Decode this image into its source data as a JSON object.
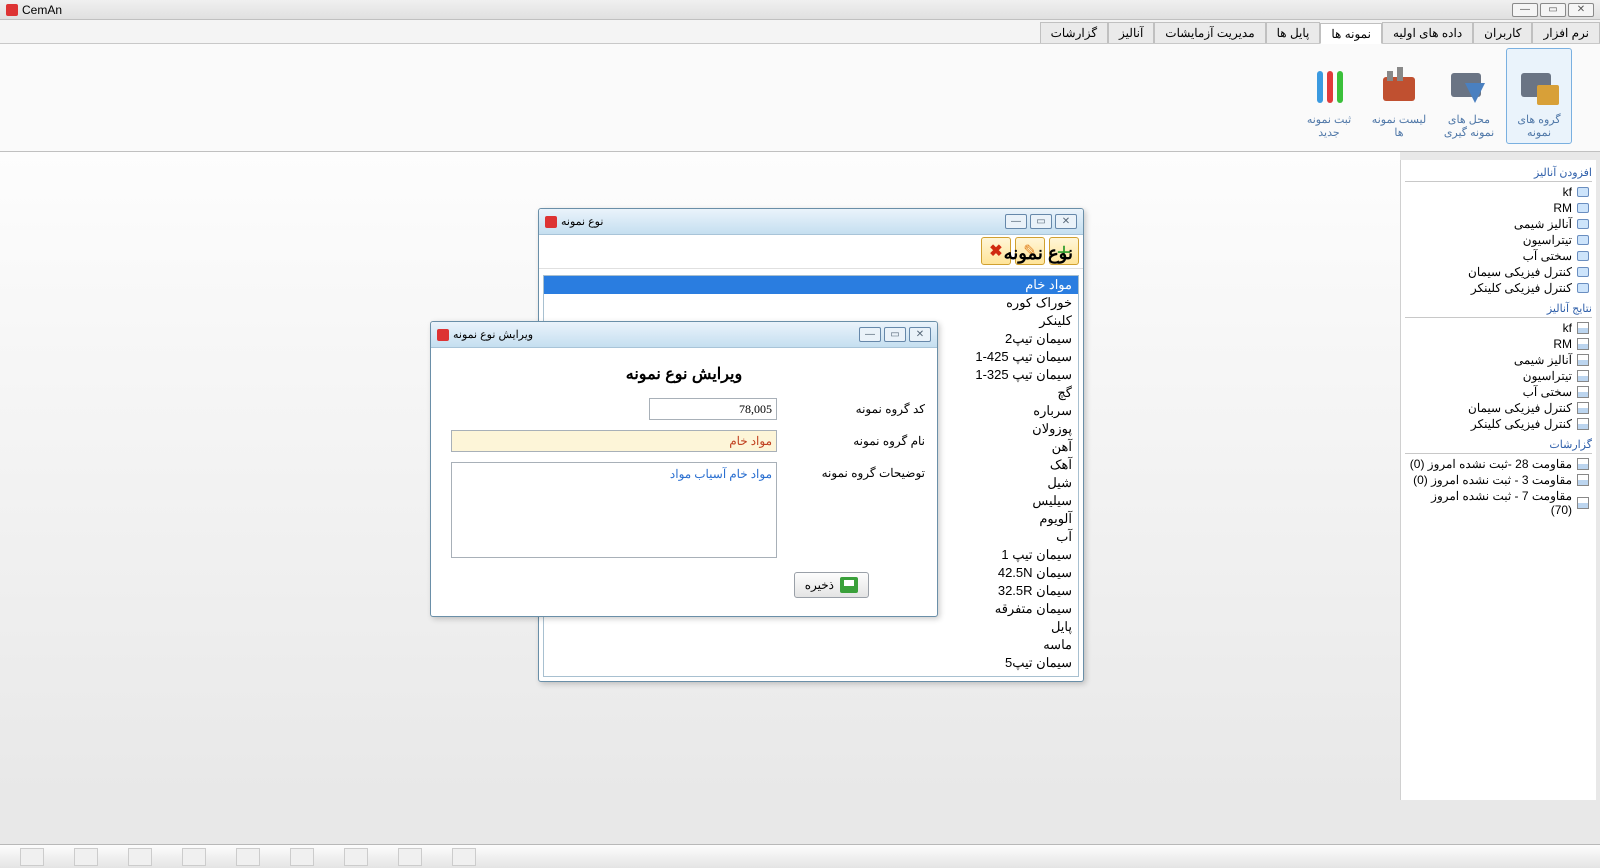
{
  "app": {
    "title": "CemAn"
  },
  "tabs": [
    "نرم افزار",
    "کاربران",
    "داده های اولیه",
    "نمونه ها",
    "پایل ها",
    "مدیریت آزمایشات",
    "آنالیز",
    "گزارشات"
  ],
  "active_tab_index": 3,
  "ribbon": [
    {
      "label": "گروه های نمونه",
      "hl": true
    },
    {
      "label": "محل های نمونه گیری",
      "hl": false
    },
    {
      "label": "لیست نمونه ها",
      "hl": false
    },
    {
      "label": "ثبت نمونه جدید",
      "hl": false
    }
  ],
  "right_panel": {
    "sections": [
      {
        "title": "افزودن آنالیز",
        "icon": "blue",
        "items": [
          "kf",
          "RM",
          "آنالیز شیمی",
          "تیتراسیون",
          "سختی آب",
          "کنترل فیزیکی سیمان",
          "کنترل فیزیکی کلینکر"
        ]
      },
      {
        "title": "نتایج آنالیز",
        "icon": "form",
        "items": [
          "kf",
          "RM",
          "آنالیز شیمی",
          "تیتراسیون",
          "سختی آب",
          "کنترل فیزیکی سیمان",
          "کنترل فیزیکی کلینکر"
        ]
      },
      {
        "title": "گزارشات",
        "icon": "form",
        "items": [
          "مقاومت 28 -ثبت نشده امروز (0)",
          "مقاومت 3 - ثبت نشده امروز (0)",
          "مقاومت 7 - ثبت نشده امروز (70)"
        ]
      }
    ]
  },
  "dlg1": {
    "title": "نوع نمونه",
    "heading": "نوع نمونه",
    "items": [
      "مواد خام",
      "خوراک کوره",
      "کلینکر",
      "سیمان تیپ2",
      "سیمان تیپ 425-1",
      "سیمان تیپ 325-1",
      "گچ",
      "سرباره",
      "پوزولان",
      "آهن",
      "آهک",
      "شیل",
      "سیلیس",
      "آلویوم",
      "آب",
      "سیمان تیپ 1",
      "سیمان 42.5N",
      "سیمان 32.5R",
      "سیمان متفرقه",
      "پایل",
      "ماسه",
      "سیمان تیپ5"
    ],
    "selected_index": 0
  },
  "dlg2": {
    "title": "ویرایش نوع نمونه",
    "heading": "ویرایش نوع نمونه",
    "code_label": "کد گروه نمونه",
    "code_value": "78,005",
    "name_label": "نام گروه نمونه",
    "name_value": "مواد خام",
    "desc_label": "توضیحات گروه نمونه",
    "desc_value": "مواد خام آسیاب مواد",
    "save_label": "ذخیره"
  }
}
